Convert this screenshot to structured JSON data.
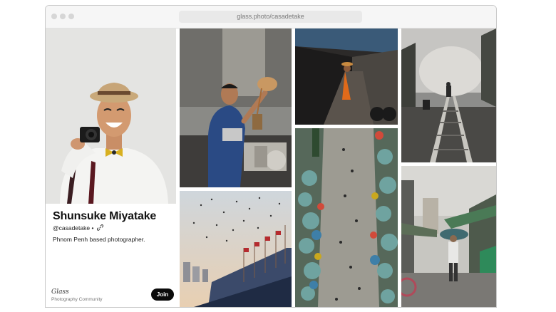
{
  "browser": {
    "url": "glass.photo/casadetake"
  },
  "profile": {
    "name": "Shunsuke Miyatake",
    "handle": "@casadetake",
    "separator": "•",
    "bio": "Phnom Penh based photographer.",
    "logo_text": "Glass",
    "community_label": "Photography Community",
    "join_label": "Join"
  },
  "icons": {
    "link": "link-icon",
    "window_controls": [
      "close-dot-icon",
      "minimize-dot-icon",
      "maximize-dot-icon"
    ]
  },
  "colors": {
    "window_dots": "#d6d6d6",
    "join_button_bg": "#0b0b0b",
    "join_button_text": "#ffffff"
  }
}
